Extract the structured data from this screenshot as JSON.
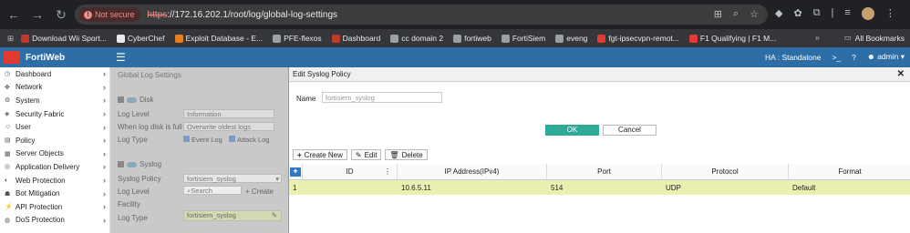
{
  "browser": {
    "security_label": "Not secure",
    "url_proto": "https",
    "url_rest": "://172.16.202.1/root/log/global-log-settings",
    "bookmarks": [
      {
        "label": "Download Wii Sport...",
        "color": "#c0392b"
      },
      {
        "label": "CyberChef",
        "color": "#e8eaed"
      },
      {
        "label": "Exploit Database - E...",
        "color": "#e67e22"
      },
      {
        "label": "PFE-flexos",
        "color": "#9aa0a6"
      },
      {
        "label": "Dashboard",
        "color": "#c0392b"
      },
      {
        "label": "cc domain 2",
        "color": "#9aa0a6"
      },
      {
        "label": "fortiweb",
        "color": "#9aa0a6"
      },
      {
        "label": "FortiSiem",
        "color": "#9aa0a6"
      },
      {
        "label": "eveng",
        "color": "#9aa0a6"
      },
      {
        "label": "fgt-ipsecvpn-remot...",
        "color": "#e53935"
      },
      {
        "label": "F1 Qualifying | F1 M...",
        "color": "#e53935"
      }
    ],
    "all_bookmarks": "All Bookmarks"
  },
  "app": {
    "title": "FortiWeb",
    "ha_status": "HA : Standalone",
    "user": "admin"
  },
  "sidebar": {
    "items": [
      {
        "label": "Dashboard",
        "icon": "dashboard-icon"
      },
      {
        "label": "Network",
        "icon": "network-icon"
      },
      {
        "label": "System",
        "icon": "system-icon"
      },
      {
        "label": "Security Fabric",
        "icon": "fabric-icon"
      },
      {
        "label": "User",
        "icon": "user-icon"
      },
      {
        "label": "Policy",
        "icon": "policy-icon"
      },
      {
        "label": "Server Objects",
        "icon": "server-icon"
      },
      {
        "label": "Application Delivery",
        "icon": "delivery-icon"
      },
      {
        "label": "Web Protection",
        "icon": "shield-icon"
      },
      {
        "label": "Bot Mitigation",
        "icon": "bot-icon"
      },
      {
        "label": "API Protection",
        "icon": "api-icon"
      },
      {
        "label": "DoS Protection",
        "icon": "dos-icon"
      }
    ]
  },
  "background_page": {
    "title": "Global Log Settings",
    "disk_section": "Disk",
    "log_level_label": "Log Level",
    "log_level_value": "Information",
    "when_full_label": "When log disk is full",
    "when_full_value": "Overwrite oldest logs",
    "log_type_label": "Log Type",
    "event_log": "Event Log",
    "attack_log": "Attack Log",
    "syslog_section": "Syslog",
    "syslog_policy_label": "Syslog Policy",
    "syslog_policy_value": "fortisiem_syslog",
    "search_placeholder": "Search",
    "create_label": "Create",
    "log_level2_label": "Log Level",
    "facility_label": "Facility",
    "log_type2_label": "Log Type",
    "dropdown_option": "fortisiem_syslog"
  },
  "dialog": {
    "title": "Edit Syslog Policy",
    "name_label": "Name",
    "name_value": "fortisiem_syslog",
    "ok_label": "OK",
    "cancel_label": "Cancel",
    "create_new_label": "Create New",
    "edit_label": "Edit",
    "delete_label": "Delete",
    "columns": [
      "ID",
      "IP Address(IPv4)",
      "Port",
      "Protocol",
      "Format"
    ],
    "rows": [
      {
        "id": "1",
        "ip": "10.6.5.11",
        "port": "514",
        "protocol": "UDP",
        "format": "Default"
      }
    ]
  }
}
